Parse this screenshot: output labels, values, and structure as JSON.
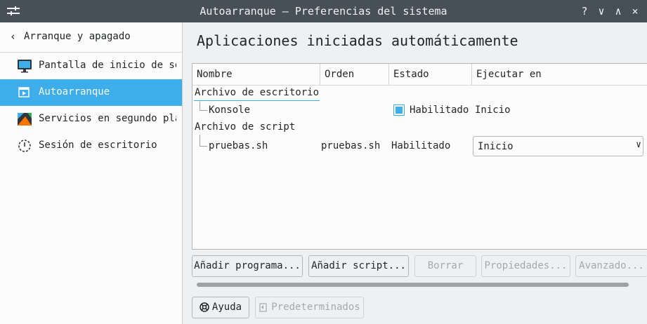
{
  "window": {
    "title": "Autoarranque — Preferencias del sistema",
    "controls": {
      "help": "?",
      "minimize": "∨",
      "maximize": "∧",
      "close": "×"
    }
  },
  "sidebar": {
    "back_label": "Arranque y apagado",
    "items": [
      {
        "label": "Pantalla de inicio de sesión",
        "icon": "monitor-icon"
      },
      {
        "label": "Autoarranque",
        "icon": "autostart-icon"
      },
      {
        "label": "Servicios en segundo plano",
        "icon": "background-services-icon"
      },
      {
        "label": "Sesión de escritorio",
        "icon": "desktop-session-icon"
      }
    ],
    "active_index": 1
  },
  "main": {
    "title": "Aplicaciones iniciadas automáticamente",
    "columns": [
      "Nombre",
      "Orden",
      "Estado",
      "Ejecutar en"
    ],
    "groups": [
      {
        "label": "Archivo de escritorio",
        "rows": [
          {
            "name": "Konsole",
            "order": "",
            "status": "Habilitado",
            "status_checked": true,
            "run_at": "Inicio"
          }
        ]
      },
      {
        "label": "Archivo de script",
        "rows": [
          {
            "name": "pruebas.sh",
            "order": "pruebas.sh",
            "status": "Habilitado",
            "run_at": "Inicio"
          }
        ]
      }
    ],
    "buttons": {
      "add_program": "Añadir programa...",
      "add_script": "Añadir script...",
      "remove": "Borrar",
      "properties": "Propiedades...",
      "advanced": "Avanzado..."
    },
    "footer": {
      "help": "Ayuda",
      "defaults": "Predeterminados"
    }
  },
  "colors": {
    "accent": "#3daee9",
    "titlebar": "#475057",
    "window_bg": "#eff0f1",
    "view_bg": "#fcfcfc",
    "disabled_text": "#a6a9ab"
  }
}
